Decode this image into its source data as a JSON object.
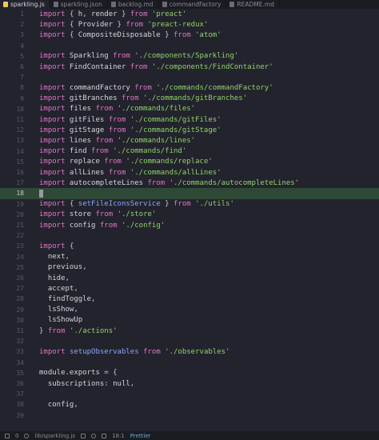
{
  "tabs": [
    {
      "label": "sparkling.js",
      "active": true
    },
    {
      "label": "sparkling.json",
      "active": false
    },
    {
      "label": "backlog.md",
      "active": false
    },
    {
      "label": "commandFactory",
      "active": false
    },
    {
      "label": "README.md",
      "active": false
    }
  ],
  "lines": [
    {
      "n": "1",
      "code": "import { h, render } from 'preact'"
    },
    {
      "n": "2",
      "code": "import { Provider } from 'preact-redux'"
    },
    {
      "n": "3",
      "code": "import { CompositeDisposable } from 'atom'"
    },
    {
      "n": "4",
      "code": ""
    },
    {
      "n": "5",
      "code": "import Sparkling from './components/Sparkling'"
    },
    {
      "n": "6",
      "code": "import FindContainer from './components/FindContainer'"
    },
    {
      "n": "7",
      "code": ""
    },
    {
      "n": "8",
      "code": "import commandFactory from './commands/commandFactory'"
    },
    {
      "n": "9",
      "code": "import gitBranches from './commands/gitBranches'"
    },
    {
      "n": "10",
      "code": "import files from './commands/files'"
    },
    {
      "n": "11",
      "code": "import gitFiles from './commands/gitFiles'"
    },
    {
      "n": "12",
      "code": "import gitStage from './commands/gitStage'"
    },
    {
      "n": "13",
      "code": "import lines from './commands/lines'"
    },
    {
      "n": "14",
      "code": "import find from './commands/find'"
    },
    {
      "n": "15",
      "code": "import replace from './commands/replace'"
    },
    {
      "n": "16",
      "code": "import allLines from './commands/allLines'"
    },
    {
      "n": "17",
      "code": "import autocompleteLines from './commands/autocompleteLines'"
    },
    {
      "n": "18",
      "code": "",
      "current": true
    },
    {
      "n": "19",
      "code": "import { setFileIconsService } from './utils'"
    },
    {
      "n": "20",
      "code": "import store from './store'"
    },
    {
      "n": "21",
      "code": "import config from './config'"
    },
    {
      "n": "22",
      "code": ""
    },
    {
      "n": "23",
      "code": "import {"
    },
    {
      "n": "24",
      "code": "  next,"
    },
    {
      "n": "25",
      "code": "  previous,"
    },
    {
      "n": "26",
      "code": "  hide,"
    },
    {
      "n": "27",
      "code": "  accept,"
    },
    {
      "n": "28",
      "code": "  findToggle,"
    },
    {
      "n": "29",
      "code": "  lsShow,"
    },
    {
      "n": "30",
      "code": "  lsShowUp"
    },
    {
      "n": "31",
      "code": "} from './actions'"
    },
    {
      "n": "32",
      "code": ""
    },
    {
      "n": "33",
      "code": "import setupObservables from './observables'"
    },
    {
      "n": "34",
      "code": ""
    },
    {
      "n": "35",
      "code": "module.exports = {"
    },
    {
      "n": "36",
      "code": "  subscriptions: null,"
    },
    {
      "n": "37",
      "code": ""
    },
    {
      "n": "38",
      "code": "  config,"
    },
    {
      "n": "39",
      "code": ""
    }
  ],
  "status": {
    "diagnostics_count": "0",
    "file_path": "lib/sparkling.js",
    "cursor_pos": "18:1",
    "formatter": "Prettier"
  },
  "colors": {
    "background": "#23232d",
    "current_line": "#2e4a37",
    "keyword": "#e075c4",
    "string": "#8ed46a",
    "function": "#82aaff"
  }
}
